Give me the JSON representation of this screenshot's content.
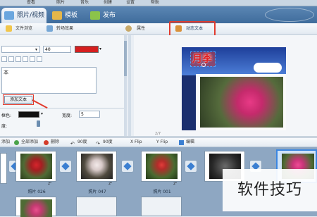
{
  "menu": [
    "查看",
    "照片",
    "音乐",
    "创建",
    "设置",
    "帮助"
  ],
  "tabs": [
    {
      "label": "照片/视频"
    },
    {
      "label": "模板"
    },
    {
      "label": "发布"
    }
  ],
  "toolbar": {
    "browse": "文件浏览",
    "transition": "转场效果",
    "properties": "属性",
    "dynamic_text": "动态文本"
  },
  "text_panel": {
    "font_size": "40",
    "color_hex": "#d61f1f",
    "text_prefix": "本",
    "add_text_button": "添加文本",
    "stroke_label": "框色:",
    "stroke_width_label": "宽度:",
    "stroke_width": "5",
    "angle_label": "度:"
  },
  "preview": {
    "title_text": "月季",
    "time": "2/7"
  },
  "strip_toolbar": {
    "add": "添加",
    "add_all": "全部添加",
    "delete": "删除",
    "rot_left": "90度",
    "rot_right": "90度",
    "xflip": "X Flip",
    "yflip": "Y Flip",
    "edit": "编辑"
  },
  "thumbs": [
    {
      "caption": "照片 026",
      "num": "2\""
    },
    {
      "caption": "照片 047",
      "num": "2\""
    },
    {
      "caption": "照片 001",
      "num": "2\""
    }
  ],
  "watermark": "软件技巧",
  "colors": {
    "accent": "#e23b2e",
    "tabbar": "#4a77a8",
    "strip": "#8ea7c2"
  }
}
